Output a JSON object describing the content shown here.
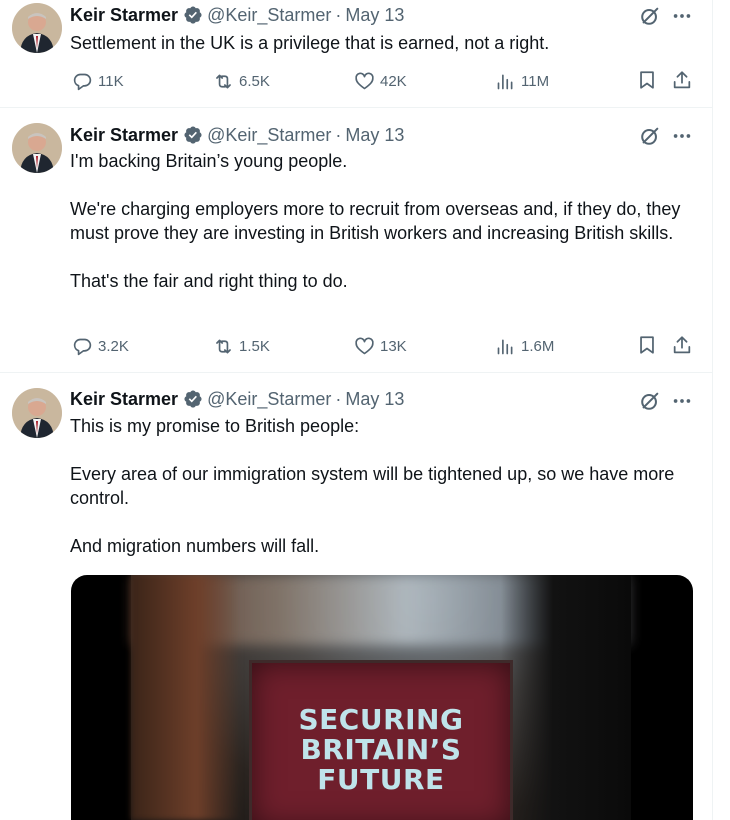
{
  "tweets": [
    {
      "name": "Keir Starmer",
      "handle": "@Keir_Starmer",
      "separator": "·",
      "date": "May 13",
      "text": "Settlement in the UK is a privilege that is earned, not a right.",
      "stats": {
        "replies": "11K",
        "reposts": "6.5K",
        "likes": "42K",
        "views": "11M"
      }
    },
    {
      "name": "Keir Starmer",
      "handle": "@Keir_Starmer",
      "separator": "·",
      "date": "May 13",
      "text": "I'm backing Britain’s young people.\n\nWe're charging employers more to recruit from overseas and, if they do, they must prove they are investing in British workers and increasing British skills.\n\nThat's the fair and right thing to do.",
      "stats": {
        "replies": "3.2K",
        "reposts": "1.5K",
        "likes": "13K",
        "views": "1.6M"
      }
    },
    {
      "name": "Keir Starmer",
      "handle": "@Keir_Starmer",
      "separator": "·",
      "date": "May 13",
      "text": "This is my promise to British people:\n\nEvery area of our immigration system will be tightened up, so we have more control.\n\nAnd migration numbers will fall.",
      "media": {
        "sign_text": "SECURING\nBRITAIN’S\nFUTURE"
      }
    }
  ],
  "icons": {
    "verified": "verified-badge-icon",
    "grok": "grok-icon",
    "more": "more-icon",
    "reply": "reply-icon",
    "repost": "repost-icon",
    "like": "like-icon",
    "views": "views-icon",
    "bookmark": "bookmark-icon",
    "share": "share-icon"
  },
  "colors": {
    "text": "#0f1419",
    "secondary": "#536471",
    "verified": "#536471",
    "divider": "#eff3f4"
  }
}
